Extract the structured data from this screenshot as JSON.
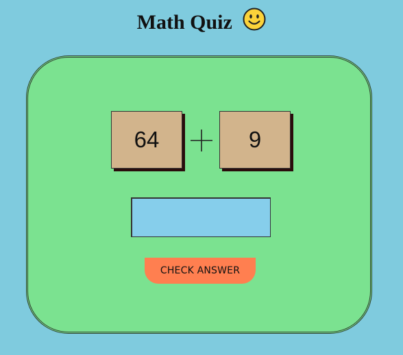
{
  "page": {
    "title": "Math Quiz",
    "title_icon": "smiley-face-icon"
  },
  "quiz": {
    "operand_a": "64",
    "operator": "+",
    "operand_b": "9",
    "answer_value": "",
    "answer_placeholder": "",
    "check_button_label": "CHECK ANSWER"
  },
  "colors": {
    "background": "#7fcbde",
    "card": "#7be290",
    "number_box": "#d2b48c",
    "answer_input": "#86ceeb",
    "check_button": "#ff7f50"
  }
}
